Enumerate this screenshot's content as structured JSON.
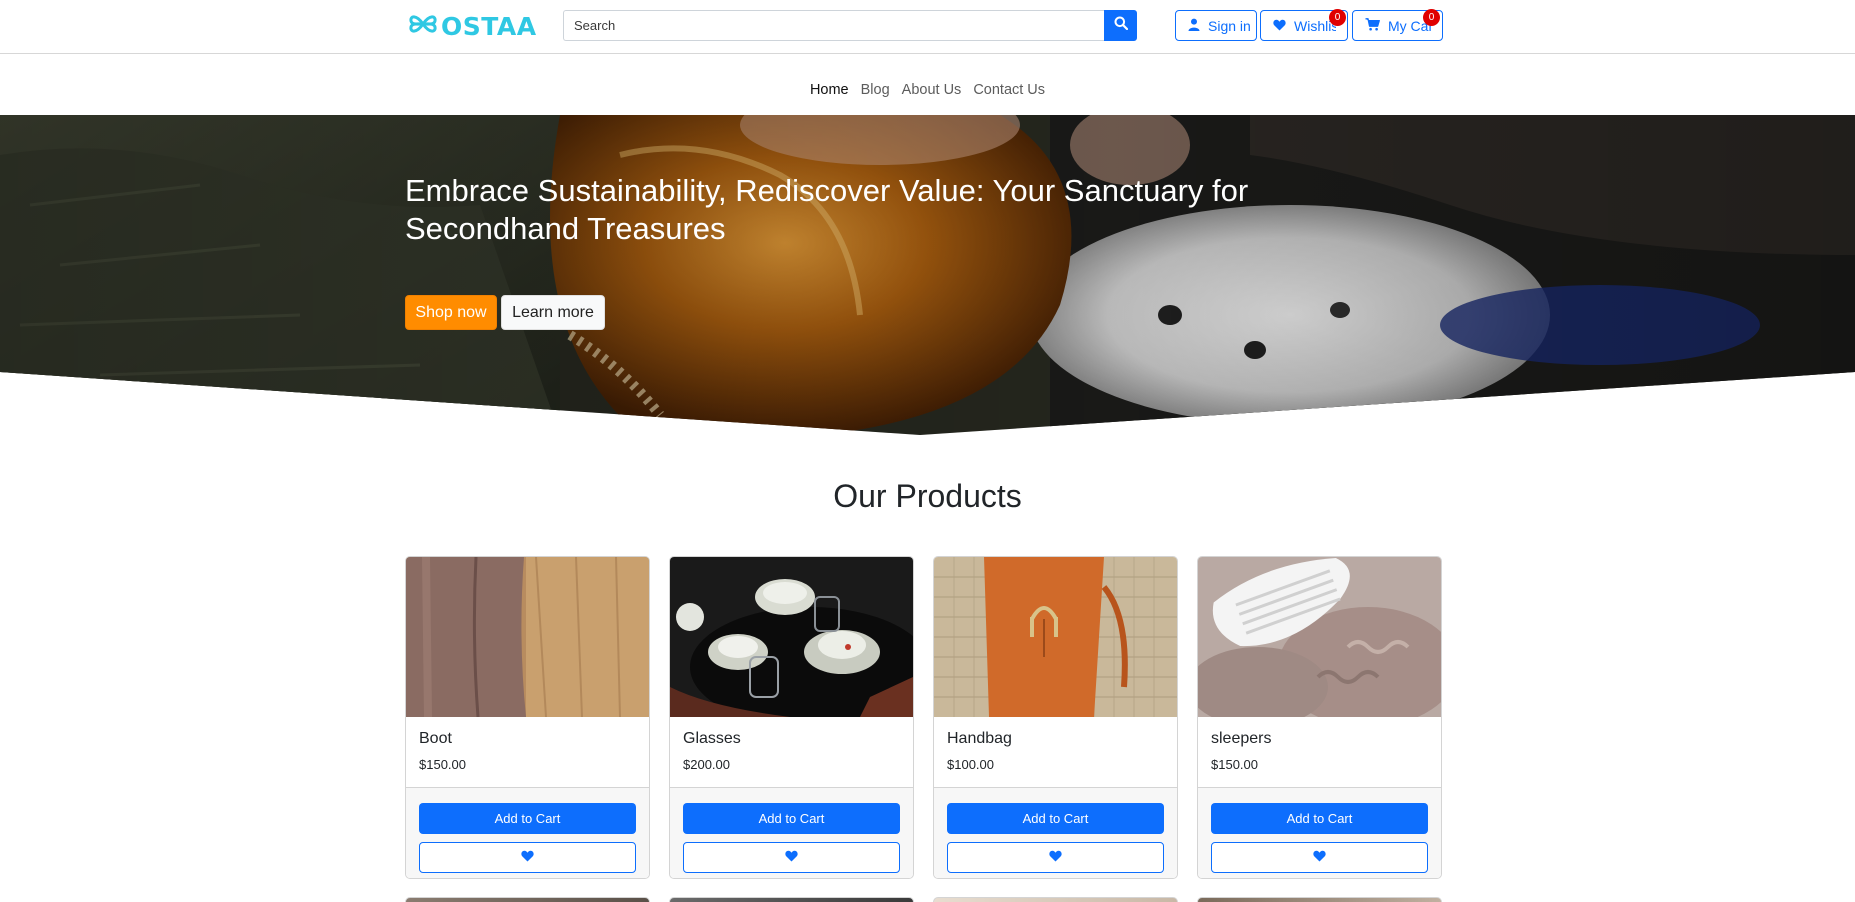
{
  "brand": {
    "logo_text": "OSTAA",
    "logo_color": "#2fc8e3"
  },
  "header": {
    "search_placeholder": "Search",
    "sign_in_label": "Sign in",
    "wishlist_label": "Wishlist",
    "wishlist_count": "0",
    "cart_label": "My Cart",
    "cart_count": "0"
  },
  "nav": {
    "items": [
      {
        "label": "Home",
        "active": true
      },
      {
        "label": "Blog",
        "active": false
      },
      {
        "label": "About Us",
        "active": false
      },
      {
        "label": "Contact Us",
        "active": false
      }
    ]
  },
  "hero": {
    "title": "Embrace Sustainability, Rediscover Value: Your Sanctuary for Secondhand Treasures",
    "shop_label": "Shop now",
    "learn_label": "Learn more"
  },
  "products": {
    "title": "Our Products",
    "add_label": "Add to Cart",
    "items": [
      {
        "name": "Boot",
        "price": "$150.00"
      },
      {
        "name": "Glasses",
        "price": "$200.00"
      },
      {
        "name": "Handbag",
        "price": "$100.00"
      },
      {
        "name": "sleepers",
        "price": "$150.00"
      }
    ]
  },
  "colors": {
    "primary": "#0d6efd",
    "accent": "#ff8c00",
    "badge": "#e00000"
  }
}
